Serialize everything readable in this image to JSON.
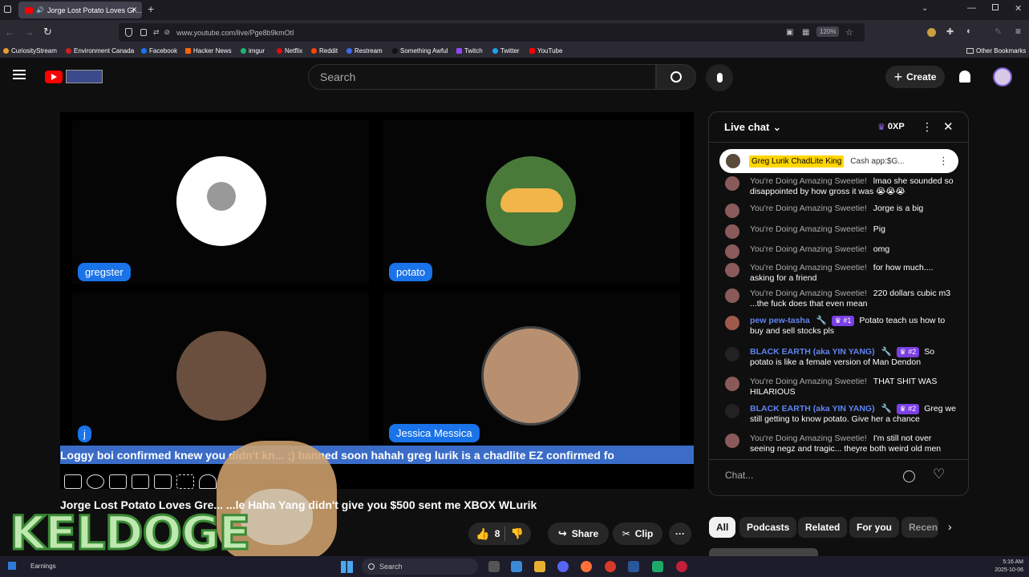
{
  "browser": {
    "tab_title": "Jorge Lost Potato Loves Gr…",
    "url": "www.youtube.com/live/Pge8b9kmOtI",
    "zoom": "120%",
    "bookmarks": [
      "CuriosityStream",
      "Environment Canada",
      "Facebook",
      "Hacker News",
      "imgur",
      "Netflix",
      "Reddit",
      "Restream",
      "Something Awful",
      "Twitch",
      "Twitter",
      "YouTube"
    ],
    "other_bookmarks": "Other Bookmarks"
  },
  "youtube": {
    "search_placeholder": "Search",
    "create_label": "Create"
  },
  "video": {
    "participants": [
      {
        "name": "gregster"
      },
      {
        "name": "potato"
      },
      {
        "name": "j"
      },
      {
        "name": "Jessica Messica"
      }
    ],
    "ticker": "Loggy boi confirmed knew you didn't kn... ;) banned soon hahah greg lurik is a chadlite EZ confirmed fo",
    "title": "Jorge Lost Potato Loves Gre...               ...le Haha Yang didn't give you $500 sent me XBOX WLurik",
    "like_count": "8",
    "share_label": "Share",
    "clip_label": "Clip",
    "overlay_text": "KELDOGE"
  },
  "chat": {
    "title": "Live chat",
    "xp": "0XP",
    "pinned_author": "Greg Lurik ChadLite King",
    "pinned_text": "Cash app:$G...",
    "messages": [
      {
        "author": "You're Doing Amazing Sweetie!",
        "text": "lmao she sounded so disappointed by how gross it was 😭😭😭",
        "badge": ""
      },
      {
        "author": "You're Doing Amazing Sweetie!",
        "text": "Jorge is a big",
        "badge": ""
      },
      {
        "author": "You're Doing Amazing Sweetie!",
        "text": "Pig",
        "badge": ""
      },
      {
        "author": "You're Doing Amazing Sweetie!",
        "text": "omg",
        "badge": ""
      },
      {
        "author": "You're Doing Amazing Sweetie!",
        "text": "for how much.... asking for a friend",
        "badge": ""
      },
      {
        "author": "You're Doing Amazing Sweetie!",
        "text": "220 dollars cubic m3 ...the fuck does that even mean",
        "badge": ""
      },
      {
        "author": "pew pew-tasha",
        "text": "Potato teach us how to buy and sell stocks pls",
        "badge": "#1"
      },
      {
        "author": "BLACK EARTH (aka YIN YANG)",
        "text": "So potato is like a female version of Man Dendon",
        "badge": "#2"
      },
      {
        "author": "You're Doing Amazing Sweetie!",
        "text": "THAT SHIT WAS HILARIOUS",
        "badge": ""
      },
      {
        "author": "BLACK EARTH (aka YIN YANG)",
        "text": "Greg we still getting to know potato. Give her a chance",
        "badge": "#2"
      },
      {
        "author": "You're Doing Amazing Sweetie!",
        "text": "I'm still not over seeing negz and tragic... theyre both weird old men",
        "badge": ""
      }
    ],
    "input_placeholder": "Chat..."
  },
  "chips": [
    "All",
    "Podcasts",
    "Related",
    "For you",
    "Recen"
  ],
  "taskbar": {
    "weather": "Earnings",
    "search": "Search",
    "time": "5:16 AM",
    "date": "2025-10-06"
  }
}
